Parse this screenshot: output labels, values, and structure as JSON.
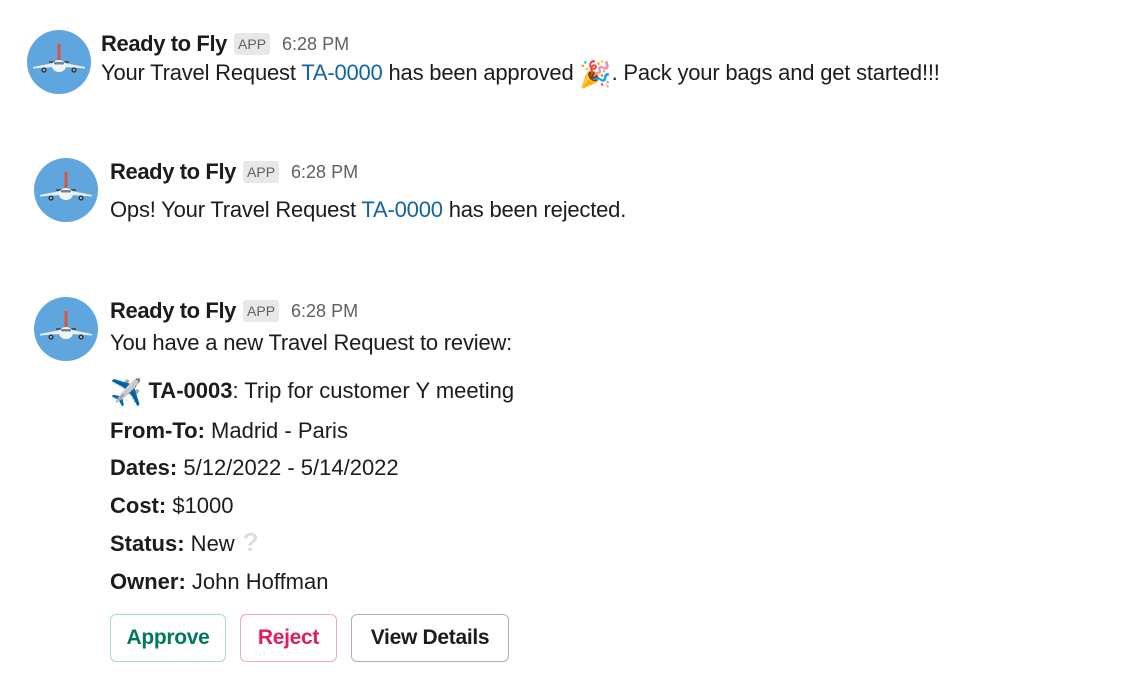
{
  "colors": {
    "link": "#1264a3",
    "approve": "#007a5a",
    "reject": "#e01e5a",
    "avatar_bg": "#5fa6df"
  },
  "messages": [
    {
      "sender": "Ready to Fly",
      "badge": "APP",
      "time": "6:28 PM",
      "avatar_icon": "airplane-front-icon",
      "text_before": "Your Travel Request ",
      "link": "TA-0000",
      "text_middle": " has been approved ",
      "emoji": "🎉",
      "emoji_name": "party-popper-icon",
      "text_after": ". Pack your bags and get started!!!"
    },
    {
      "sender": "Ready to Fly",
      "badge": "APP",
      "time": "6:28 PM",
      "avatar_icon": "airplane-front-icon",
      "text_before": "Ops! Your Travel Request ",
      "link": "TA-0000",
      "text_after": " has been rejected."
    },
    {
      "sender": "Ready to Fly",
      "badge": "APP",
      "time": "6:28 PM",
      "avatar_icon": "airplane-front-icon",
      "intro": "You have a new Travel Request to review:",
      "request": {
        "emoji": "✈️",
        "emoji_name": "airplane-icon",
        "id": "TA-0003",
        "title": ": Trip for customer Y meeting"
      },
      "fields": [
        {
          "label": "From-To:",
          "value": " Madrid - Paris"
        },
        {
          "label": "Dates:",
          "value": " 5/12/2022 - 5/14/2022"
        },
        {
          "label": "Cost:",
          "value": " $1000"
        },
        {
          "label": "Status:",
          "value": " New",
          "icon": "?",
          "icon_name": "question-mark-icon"
        },
        {
          "label": "Owner:",
          "value": " John Hoffman"
        }
      ],
      "buttons": {
        "approve": "Approve",
        "reject": "Reject",
        "view_details": "View Details"
      }
    }
  ]
}
